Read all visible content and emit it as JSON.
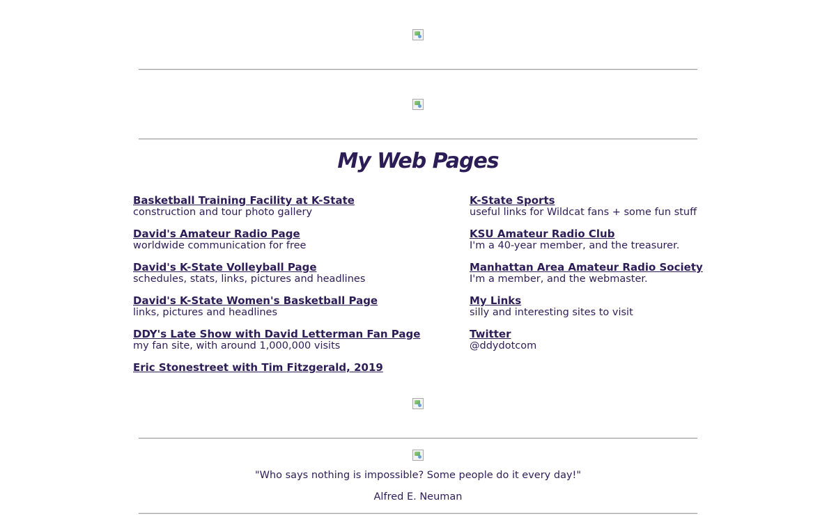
{
  "heading": "My Web Pages",
  "left_links": [
    {
      "label": "Basketball Training Facility at K-State",
      "desc": "construction and tour photo gallery"
    },
    {
      "label": "David's Amateur Radio Page",
      "desc": "worldwide communication for free"
    },
    {
      "label": "David's K-State Volleyball Page",
      "desc": "schedules, stats, links, pictures and headlines"
    },
    {
      "label": "David's K-State Women's Basketball Page",
      "desc": "links, pictures and headlines"
    },
    {
      "label": "DDY's Late Show with David Letterman Fan Page",
      "desc": "my fan site, with around 1,000,000 visits"
    },
    {
      "label": "Eric Stonestreet with Tim Fitzgerald, 2019",
      "desc": ""
    }
  ],
  "right_links": [
    {
      "label": "K-State Sports",
      "desc": "useful links for Wildcat fans + some fun stuff"
    },
    {
      "label": "KSU Amateur Radio Club",
      "desc": "I'm a 40-year member, and the treasurer."
    },
    {
      "label": "Manhattan Area Amateur Radio Society",
      "desc": "I'm a member, and the webmaster."
    },
    {
      "label": "My Links",
      "desc": "silly and interesting sites to visit"
    },
    {
      "label": "Twitter",
      "desc": "@ddydotcom"
    }
  ],
  "quote": {
    "text": "\"Who says nothing is impossible? Some people do it every day!\"",
    "author": "Alfred E. Neuman"
  },
  "colors": {
    "text": "#2d1d57",
    "rule": "#a0a0a0",
    "background": "#ffffff"
  },
  "images": [
    "broken-image-icon",
    "broken-image-icon",
    "broken-image-icon",
    "broken-image-icon"
  ]
}
